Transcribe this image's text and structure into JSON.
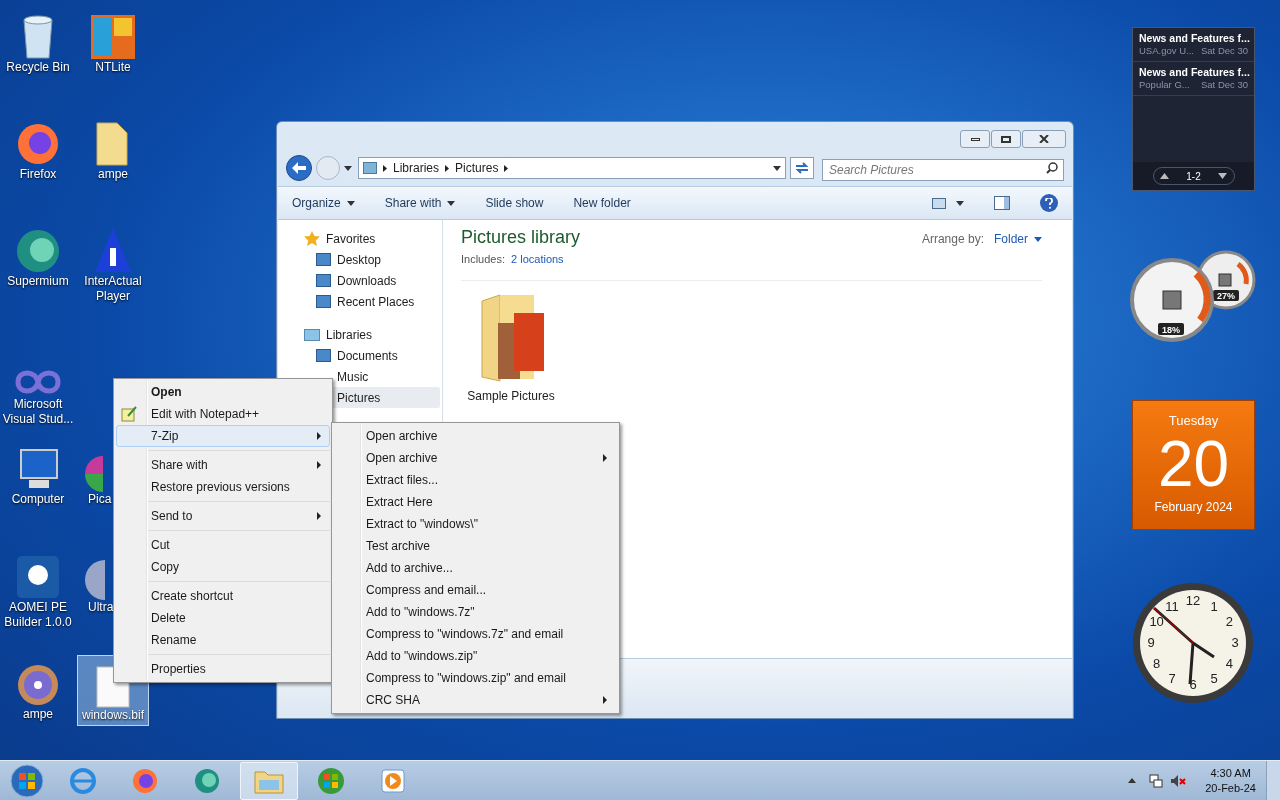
{
  "desktop_icons": [
    {
      "label": "Recycle Bin",
      "selected": false,
      "covered": false
    },
    {
      "label": "NTLite",
      "selected": false,
      "covered": false
    },
    {
      "label": "Firefox",
      "selected": false,
      "covered": false
    },
    {
      "label": "ampe",
      "selected": false,
      "covered": false
    },
    {
      "label": "Supermium",
      "selected": false,
      "covered": false
    },
    {
      "label": "InterActual Player",
      "selected": false,
      "covered": false
    },
    {
      "label": "Microsoft Visual Stud...",
      "selected": false,
      "covered": false
    },
    {
      "label": "Computer",
      "selected": false,
      "covered": false
    },
    {
      "label": "Pica",
      "selected": false,
      "covered": true
    },
    {
      "label": "AOMEI PE Builder 1.0.0",
      "selected": false,
      "covered": false
    },
    {
      "label": "Ultra",
      "selected": false,
      "covered": true
    },
    {
      "label": "ampe",
      "selected": false,
      "covered": false
    },
    {
      "label": "windows.bif",
      "selected": true,
      "covered": false
    }
  ],
  "explorer": {
    "breadcrumb": [
      "Libraries",
      "Pictures"
    ],
    "search": {
      "placeholder": "Search Pictures"
    },
    "toolbar": [
      {
        "label": "Organize",
        "dropdown": true
      },
      {
        "label": "Share with",
        "dropdown": true
      },
      {
        "label": "Slide show",
        "dropdown": false
      },
      {
        "label": "New folder",
        "dropdown": false
      }
    ],
    "nav": [
      {
        "label": "Favorites",
        "children": [
          {
            "label": "Desktop",
            "selected": false
          },
          {
            "label": "Downloads",
            "selected": false
          },
          {
            "label": "Recent Places",
            "selected": false
          }
        ]
      },
      {
        "label": "Libraries",
        "children": [
          {
            "label": "Documents",
            "selected": false
          },
          {
            "label": "Music",
            "selected": false
          },
          {
            "label": "Pictures",
            "selected": true
          }
        ]
      }
    ],
    "title": "Pictures library",
    "includes_label": "Includes:",
    "includes_link": "2 locations",
    "arrange_label": "Arrange by:",
    "arrange_value": "Folder",
    "items": [
      {
        "label": "Sample Pictures"
      }
    ]
  },
  "context_menu": {
    "groups": [
      [
        {
          "label": "Open",
          "default": true,
          "has_icon": false,
          "has_submenu": false,
          "selected": false
        },
        {
          "label": "Edit with Notepad++",
          "default": false,
          "has_icon": true,
          "has_submenu": false,
          "selected": false
        },
        {
          "label": "7-Zip",
          "default": false,
          "has_icon": false,
          "has_submenu": true,
          "selected": true
        }
      ],
      [
        {
          "label": "Share with",
          "default": false,
          "has_icon": false,
          "has_submenu": true,
          "selected": false
        },
        {
          "label": "Restore previous versions",
          "default": false,
          "has_icon": false,
          "has_submenu": false,
          "selected": false
        }
      ],
      [
        {
          "label": "Send to",
          "default": false,
          "has_icon": false,
          "has_submenu": true,
          "selected": false
        }
      ],
      [
        {
          "label": "Cut",
          "default": false,
          "has_icon": false,
          "has_submenu": false,
          "selected": false
        },
        {
          "label": "Copy",
          "default": false,
          "has_icon": false,
          "has_submenu": false,
          "selected": false
        }
      ],
      [
        {
          "label": "Create shortcut",
          "default": false,
          "has_icon": false,
          "has_submenu": false,
          "selected": false
        },
        {
          "label": "Delete",
          "default": false,
          "has_icon": false,
          "has_submenu": false,
          "selected": false
        },
        {
          "label": "Rename",
          "default": false,
          "has_icon": false,
          "has_submenu": false,
          "selected": false
        }
      ],
      [
        {
          "label": "Properties",
          "default": false,
          "has_icon": false,
          "has_submenu": false,
          "selected": false
        }
      ]
    ]
  },
  "submenu": {
    "items": [
      {
        "label": "Open archive",
        "has_submenu": false
      },
      {
        "label": "Open archive",
        "has_submenu": true
      },
      {
        "label": "Extract files...",
        "has_submenu": false
      },
      {
        "label": "Extract Here",
        "has_submenu": false
      },
      {
        "label": "Extract to \"windows\\\"",
        "has_submenu": false
      },
      {
        "label": "Test archive",
        "has_submenu": false
      },
      {
        "label": "Add to archive...",
        "has_submenu": false
      },
      {
        "label": "Compress and email...",
        "has_submenu": false
      },
      {
        "label": "Add to \"windows.7z\"",
        "has_submenu": false
      },
      {
        "label": "Compress to \"windows.7z\" and email",
        "has_submenu": false
      },
      {
        "label": "Add to \"windows.zip\"",
        "has_submenu": false
      },
      {
        "label": "Compress to \"windows.zip\" and email",
        "has_submenu": false
      },
      {
        "label": "CRC SHA",
        "has_submenu": true
      }
    ]
  },
  "gadgets": {
    "news": {
      "items": [
        {
          "title": "News and Features f...",
          "source": "USA.gov U...",
          "date": "Sat Dec 30"
        },
        {
          "title": "News and Features f...",
          "source": "Popular G...",
          "date": "Sat Dec 30"
        }
      ],
      "pager": "1-2"
    },
    "cpu": {
      "cpu_reading": "18%",
      "memory_reading": "27%"
    },
    "calendar": {
      "weekday": "Tuesday",
      "day": "20",
      "month": "February 2024"
    },
    "clock": {
      "numerals": [
        "12",
        "11",
        "1",
        "10",
        "2",
        "9",
        "3",
        "8",
        "4",
        "7",
        "5",
        "6"
      ]
    }
  },
  "taskbar": {
    "apps": [
      {
        "selected": false
      },
      {
        "selected": false
      },
      {
        "selected": false
      },
      {
        "selected": true
      },
      {
        "selected": false
      },
      {
        "selected": false
      }
    ],
    "time": "4:30 AM",
    "date": "20-Feb-24"
  }
}
